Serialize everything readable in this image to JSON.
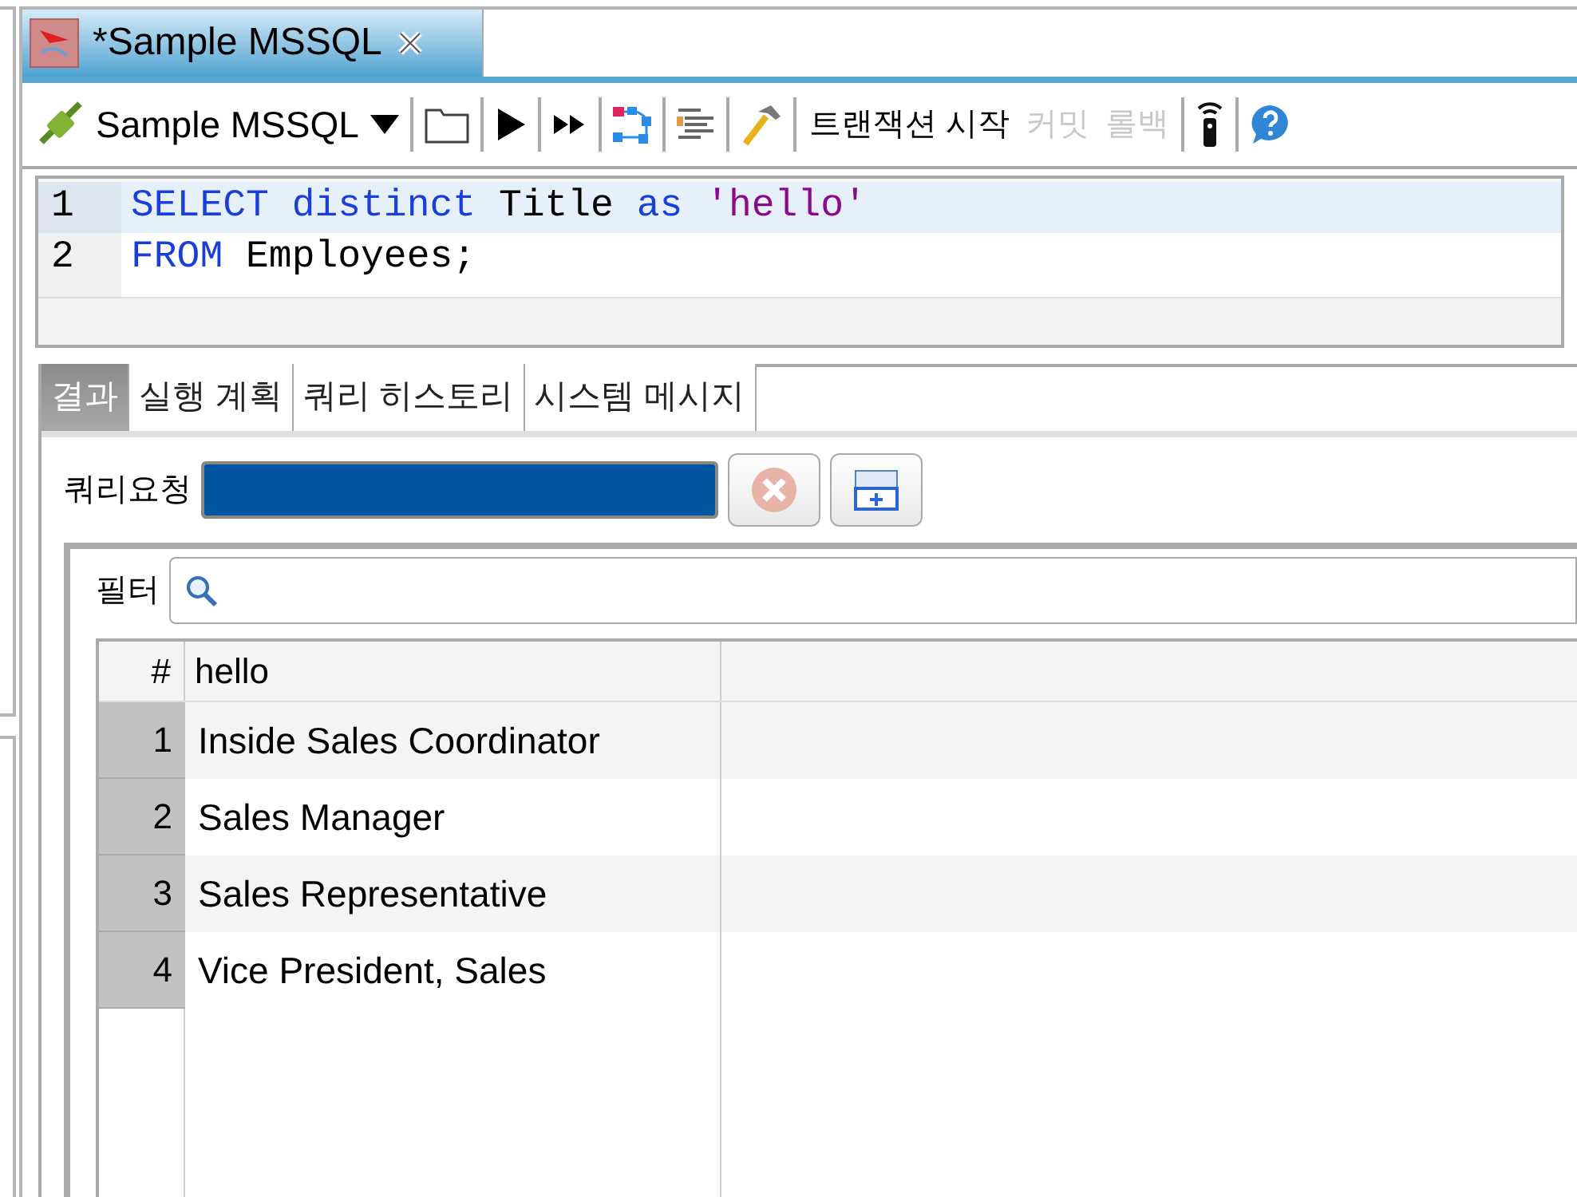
{
  "editor_tab": {
    "title": "*Sample MSSQL"
  },
  "toolbar": {
    "connection": "Sample MSSQL",
    "items": [
      {
        "kind": "folder"
      },
      {
        "kind": "run"
      },
      {
        "kind": "run-all"
      },
      {
        "kind": "diagram"
      },
      {
        "kind": "format"
      },
      {
        "kind": "hammer"
      },
      {
        "kind": "text",
        "label": "트랜잭션 시작",
        "disabled": false
      },
      {
        "kind": "text",
        "label": "커밋",
        "disabled": true
      },
      {
        "kind": "text",
        "label": "롤백",
        "disabled": true
      },
      {
        "kind": "remote"
      },
      {
        "kind": "help"
      }
    ]
  },
  "editor": {
    "lines": [
      {
        "number": "1",
        "current": true,
        "tokens": [
          {
            "kind": "keyword",
            "text": "SELECT distinct"
          },
          {
            "kind": "plain",
            "text": " Title "
          },
          {
            "kind": "keyword",
            "text": "as "
          },
          {
            "kind": "string",
            "text": "'hello'"
          }
        ]
      },
      {
        "number": "2",
        "current": false,
        "tokens": [
          {
            "kind": "keyword",
            "text": "FROM"
          },
          {
            "kind": "plain",
            "text": " Employees;"
          }
        ]
      }
    ]
  },
  "result_tabs": [
    {
      "label": "결과",
      "selected": true
    },
    {
      "label": "실행 계획",
      "selected": false
    },
    {
      "label": "쿼리 히스토리",
      "selected": false
    },
    {
      "label": "시스템 메시지",
      "selected": false
    }
  ],
  "query_status": {
    "label": "쿼리요청",
    "level": 1
  },
  "filter": {
    "label": "필터"
  },
  "grid": {
    "columns": [
      "#",
      "hello"
    ],
    "rows": [
      {
        "number": "1",
        "value": "Inside Sales Coordinator"
      },
      {
        "number": "2",
        "value": "Sales Manager"
      },
      {
        "number": "3",
        "value": "Sales Representative"
      },
      {
        "number": "4",
        "value": "Vice President, Sales"
      }
    ]
  }
}
